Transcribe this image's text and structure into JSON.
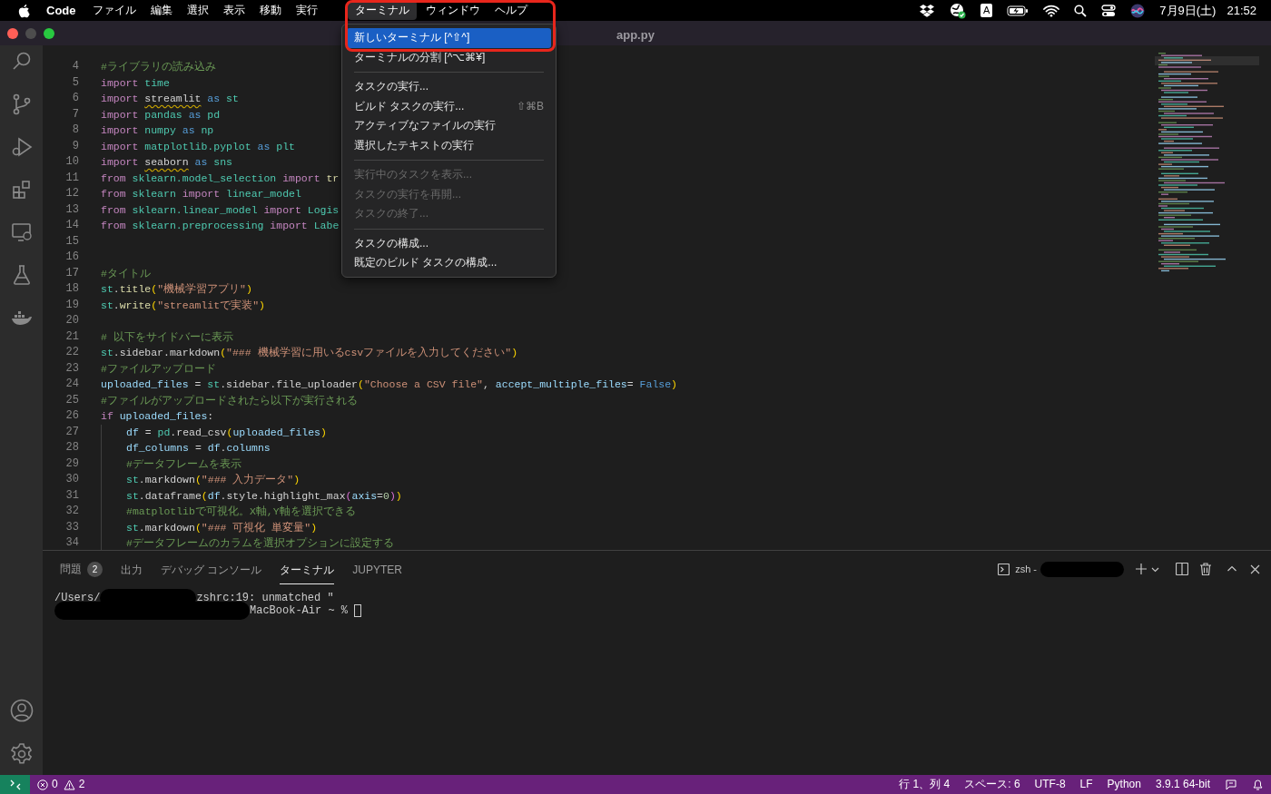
{
  "menubar": {
    "app": "Code",
    "items": [
      {
        "label": "ファイル",
        "selected": false
      },
      {
        "label": "編集",
        "selected": false
      },
      {
        "label": "選択",
        "selected": false
      },
      {
        "label": "表示",
        "selected": false
      },
      {
        "label": "移動",
        "selected": false
      },
      {
        "label": "実行",
        "selected": false
      },
      {
        "label": "ターミナル",
        "selected": true
      },
      {
        "label": "ウィンドウ",
        "selected": false
      },
      {
        "label": "ヘルプ",
        "selected": false
      }
    ],
    "input_source": "A",
    "date": "7月9日(土)",
    "time": "21:52"
  },
  "highlight_outline": true,
  "menu": [
    {
      "kind": "item",
      "label": "新しいターミナル [^⇧^]",
      "selected": true,
      "disabled": false
    },
    {
      "kind": "item",
      "label": "ターミナルの分割 [^⌥⌘¥]",
      "selected": false,
      "disabled": false
    },
    {
      "kind": "separator"
    },
    {
      "kind": "item",
      "label": "タスクの実行...",
      "selected": false,
      "disabled": false
    },
    {
      "kind": "item",
      "label": "ビルド タスクの実行...",
      "shortcut": "⇧⌘B",
      "selected": false,
      "disabled": false
    },
    {
      "kind": "item",
      "label": "アクティブなファイルの実行",
      "selected": false,
      "disabled": false
    },
    {
      "kind": "item",
      "label": "選択したテキストの実行",
      "selected": false,
      "disabled": false
    },
    {
      "kind": "separator"
    },
    {
      "kind": "item",
      "label": "実行中のタスクを表示...",
      "selected": false,
      "disabled": true
    },
    {
      "kind": "item",
      "label": "タスクの実行を再開...",
      "selected": false,
      "disabled": true
    },
    {
      "kind": "item",
      "label": "タスクの終了...",
      "selected": false,
      "disabled": true
    },
    {
      "kind": "separator"
    },
    {
      "kind": "item",
      "label": "タスクの構成...",
      "selected": false,
      "disabled": false
    },
    {
      "kind": "item",
      "label": "既定のビルド タスクの構成...",
      "selected": false,
      "disabled": false
    }
  ],
  "window": {
    "title": "app.py"
  },
  "editor": {
    "lines": [
      {
        "number": "4",
        "tokens": [
          {
            "kind": "comment",
            "text": "#ライブラリの読み込み"
          }
        ]
      },
      {
        "number": "5",
        "tokens": [
          {
            "kind": "keyword",
            "text": "import "
          },
          {
            "kind": "module",
            "text": "time"
          }
        ]
      },
      {
        "number": "6",
        "tokens": [
          {
            "kind": "keyword",
            "text": "import "
          },
          {
            "kind": "warning",
            "text": "streamlit"
          },
          {
            "kind": "builtin",
            "text": " as "
          },
          {
            "kind": "module",
            "text": "st"
          }
        ]
      },
      {
        "number": "7",
        "tokens": [
          {
            "kind": "keyword",
            "text": "import "
          },
          {
            "kind": "module",
            "text": "pandas"
          },
          {
            "kind": "builtin",
            "text": " as "
          },
          {
            "kind": "module",
            "text": "pd"
          }
        ]
      },
      {
        "number": "8",
        "tokens": [
          {
            "kind": "keyword",
            "text": "import "
          },
          {
            "kind": "module",
            "text": "numpy"
          },
          {
            "kind": "builtin",
            "text": " as "
          },
          {
            "kind": "module",
            "text": "np"
          }
        ]
      },
      {
        "number": "9",
        "tokens": [
          {
            "kind": "keyword",
            "text": "import "
          },
          {
            "kind": "module",
            "text": "matplotlib.pyplot"
          },
          {
            "kind": "builtin",
            "text": " as "
          },
          {
            "kind": "module",
            "text": "plt"
          }
        ]
      },
      {
        "number": "10",
        "tokens": [
          {
            "kind": "keyword",
            "text": "import "
          },
          {
            "kind": "warning",
            "text": "seaborn"
          },
          {
            "kind": "builtin",
            "text": " as "
          },
          {
            "kind": "module",
            "text": "sns"
          }
        ]
      },
      {
        "number": "11",
        "tokens": [
          {
            "kind": "keyword",
            "text": "from "
          },
          {
            "kind": "module",
            "text": "sklearn.model_selection"
          },
          {
            "kind": "keyword",
            "text": " import "
          },
          {
            "kind": "function",
            "text": "tr"
          }
        ]
      },
      {
        "number": "12",
        "tokens": [
          {
            "kind": "keyword",
            "text": "from "
          },
          {
            "kind": "module",
            "text": "sklearn"
          },
          {
            "kind": "keyword",
            "text": " import "
          },
          {
            "kind": "module",
            "text": "linear_model"
          }
        ]
      },
      {
        "number": "13",
        "tokens": [
          {
            "kind": "keyword",
            "text": "from "
          },
          {
            "kind": "module",
            "text": "sklearn.linear_model"
          },
          {
            "kind": "keyword",
            "text": " import "
          },
          {
            "kind": "module",
            "text": "Logis"
          }
        ]
      },
      {
        "number": "14",
        "tokens": [
          {
            "kind": "keyword",
            "text": "from "
          },
          {
            "kind": "module",
            "text": "sklearn.preprocessing"
          },
          {
            "kind": "keyword",
            "text": " import "
          },
          {
            "kind": "module",
            "text": "Labe"
          }
        ]
      },
      {
        "number": "15"
      },
      {
        "number": "16"
      },
      {
        "number": "17",
        "tokens": [
          {
            "kind": "comment",
            "text": "#タイトル"
          }
        ]
      },
      {
        "number": "18",
        "tokens": [
          {
            "kind": "module",
            "text": "st"
          },
          {
            "kind": "plain",
            "text": "."
          },
          {
            "kind": "function",
            "text": "title"
          },
          {
            "kind": "paren",
            "text": "("
          },
          {
            "kind": "string",
            "text": "\"機械学習アプリ\""
          },
          {
            "kind": "paren",
            "text": ")"
          }
        ]
      },
      {
        "number": "19",
        "tokens": [
          {
            "kind": "module",
            "text": "st"
          },
          {
            "kind": "plain",
            "text": "."
          },
          {
            "kind": "function",
            "text": "write"
          },
          {
            "kind": "paren",
            "text": "("
          },
          {
            "kind": "string",
            "text": "\"streamlitで実装\""
          },
          {
            "kind": "paren",
            "text": ")"
          }
        ]
      },
      {
        "number": "20"
      },
      {
        "number": "21",
        "tokens": [
          {
            "kind": "comment",
            "text": "# 以下をサイドバーに表示"
          }
        ]
      },
      {
        "number": "22",
        "tokens": [
          {
            "kind": "module",
            "text": "st"
          },
          {
            "kind": "plain",
            "text": ".sidebar.markdown"
          },
          {
            "kind": "paren",
            "text": "("
          },
          {
            "kind": "string",
            "text": "\"### 機械学習に用いるcsvファイルを入力してください\""
          },
          {
            "kind": "paren",
            "text": ")"
          }
        ]
      },
      {
        "number": "23",
        "tokens": [
          {
            "kind": "comment",
            "text": "#ファイルアップロード"
          }
        ]
      },
      {
        "number": "24",
        "tokens": [
          {
            "kind": "variable",
            "text": "uploaded_files"
          },
          {
            "kind": "plain",
            "text": " = "
          },
          {
            "kind": "module",
            "text": "st"
          },
          {
            "kind": "plain",
            "text": ".sidebar.file_uploader"
          },
          {
            "kind": "paren",
            "text": "("
          },
          {
            "kind": "string",
            "text": "\"Choose a CSV file\""
          },
          {
            "kind": "plain",
            "text": ", "
          },
          {
            "kind": "variable",
            "text": "accept_multiple_files"
          },
          {
            "kind": "plain",
            "text": "= "
          },
          {
            "kind": "builtin",
            "text": "False"
          },
          {
            "kind": "paren",
            "text": ")"
          }
        ]
      },
      {
        "number": "25",
        "tokens": [
          {
            "kind": "comment",
            "text": "#ファイルがアップロードされたら以下が実行される"
          }
        ]
      },
      {
        "number": "26",
        "tokens": [
          {
            "kind": "keyword",
            "text": "if "
          },
          {
            "kind": "variable",
            "text": "uploaded_files"
          },
          {
            "kind": "plain",
            "text": ":"
          }
        ],
        "children": [
          {
            "number": "27",
            "tokens": [
              {
                "kind": "variable",
                "text": "df"
              },
              {
                "kind": "plain",
                "text": " = "
              },
              {
                "kind": "module",
                "text": "pd"
              },
              {
                "kind": "plain",
                "text": ".read_csv"
              },
              {
                "kind": "paren",
                "text": "("
              },
              {
                "kind": "variable",
                "text": "uploaded_files"
              },
              {
                "kind": "paren",
                "text": ")"
              }
            ]
          },
          {
            "number": "28",
            "tokens": [
              {
                "kind": "variable",
                "text": "df_columns"
              },
              {
                "kind": "plain",
                "text": " = "
              },
              {
                "kind": "variable",
                "text": "df"
              },
              {
                "kind": "plain",
                "text": "."
              },
              {
                "kind": "variable",
                "text": "columns"
              }
            ]
          },
          {
            "number": "29",
            "tokens": [
              {
                "kind": "comment",
                "text": "#データフレームを表示"
              }
            ]
          },
          {
            "number": "30",
            "tokens": [
              {
                "kind": "module",
                "text": "st"
              },
              {
                "kind": "plain",
                "text": ".markdown"
              },
              {
                "kind": "paren",
                "text": "("
              },
              {
                "kind": "string",
                "text": "\"### 入力データ\""
              },
              {
                "kind": "paren",
                "text": ")"
              }
            ]
          },
          {
            "number": "31",
            "tokens": [
              {
                "kind": "module",
                "text": "st"
              },
              {
                "kind": "plain",
                "text": ".dataframe"
              },
              {
                "kind": "paren",
                "text": "("
              },
              {
                "kind": "variable",
                "text": "df"
              },
              {
                "kind": "plain",
                "text": ".style.highlight_max"
              },
              {
                "kind": "paren2",
                "text": "("
              },
              {
                "kind": "variable",
                "text": "axis"
              },
              {
                "kind": "plain",
                "text": "="
              },
              {
                "kind": "number",
                "text": "0"
              },
              {
                "kind": "paren2",
                "text": ")"
              },
              {
                "kind": "paren",
                "text": ")"
              }
            ]
          },
          {
            "number": "32",
            "tokens": [
              {
                "kind": "comment",
                "text": "#matplotlibで可視化。X軸,Y軸を選択できる"
              }
            ]
          },
          {
            "number": "33",
            "tokens": [
              {
                "kind": "module",
                "text": "st"
              },
              {
                "kind": "plain",
                "text": ".markdown"
              },
              {
                "kind": "paren",
                "text": "("
              },
              {
                "kind": "string",
                "text": "\"### 可視化 単変量\""
              },
              {
                "kind": "paren",
                "text": ")"
              }
            ]
          },
          {
            "number": "34",
            "tokens": [
              {
                "kind": "comment",
                "text": "#データフレームのカラムを選択オプションに設定する"
              }
            ]
          }
        ]
      }
    ]
  },
  "panel": {
    "tabs": [
      {
        "label": "問題",
        "badge": "2",
        "selected": false
      },
      {
        "label": "出力",
        "selected": false
      },
      {
        "label": "デバッグ コンソール",
        "selected": false
      },
      {
        "label": "ターミナル",
        "selected": true
      },
      {
        "label": "JUPYTER",
        "selected": false
      }
    ],
    "terminal_name": "zsh -",
    "lines": [
      [
        {
          "kind": "text",
          "text": "/Users/"
        },
        {
          "kind": "redacted"
        },
        {
          "kind": "text",
          "text": "zshrc:19: unmatched \""
        }
      ],
      [
        {
          "kind": "redacted"
        },
        {
          "kind": "text",
          "text": "MacBook-Air ~ %"
        },
        {
          "kind": "cursor"
        }
      ]
    ]
  },
  "status_bar": {
    "errors": "0",
    "warnings": "2",
    "right": [
      "行 1、列 4",
      "スペース: 6",
      "UTF-8",
      "LF",
      "Python",
      "3.9.1 64-bit"
    ]
  }
}
